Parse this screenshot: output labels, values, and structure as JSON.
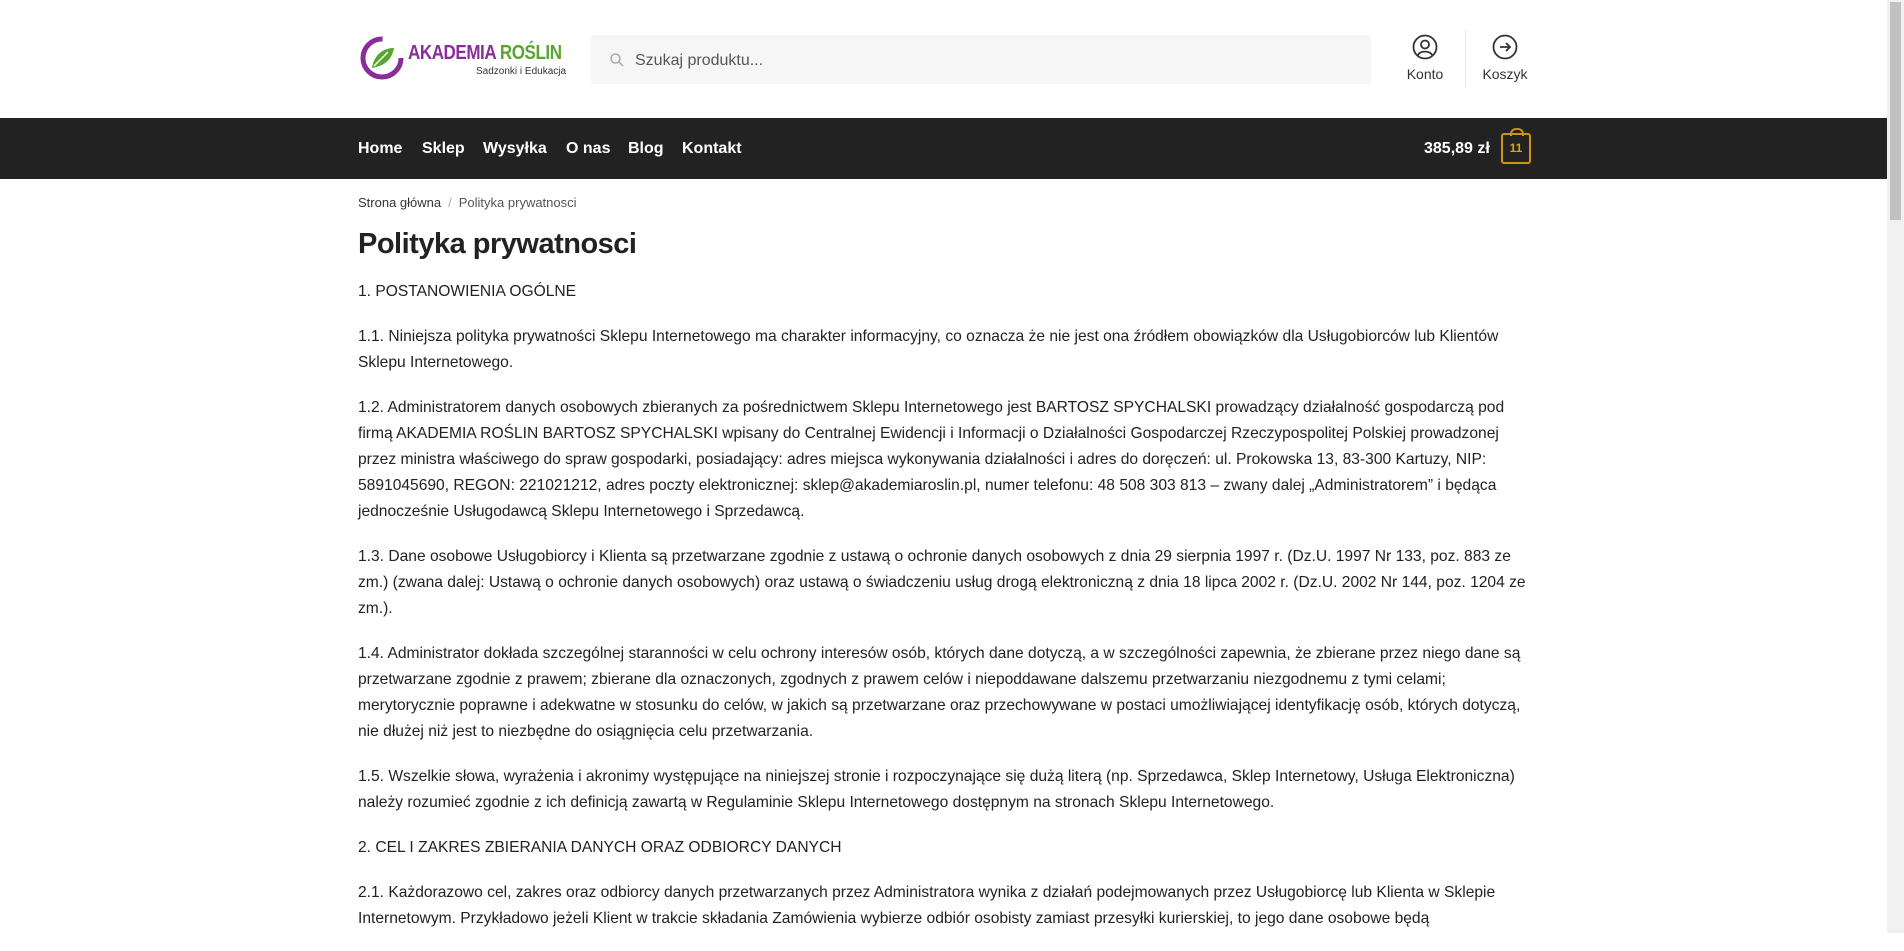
{
  "logo": {
    "title_main": "AKADEMIA ",
    "title_accent": "ROŚLIN",
    "subtitle": "Sadzonki i Edukacja"
  },
  "search": {
    "placeholder": "Szukaj produktu..."
  },
  "header_links": {
    "account_label": "Konto",
    "cart_label": "Koszyk"
  },
  "nav": {
    "items": [
      "Home",
      "Sklep",
      "Wysyłka",
      "O nas",
      "Blog",
      "Kontakt"
    ]
  },
  "cart": {
    "total": "385,89 zł",
    "count": "11"
  },
  "breadcrumb": {
    "home": "Strona główna",
    "current": "Polityka prywatnosci"
  },
  "page": {
    "title": "Polityka prywatnosci",
    "paragraphs": [
      "1. POSTANOWIENIA OGÓLNE",
      "1.1. Niniejsza polityka prywatności Sklepu Internetowego ma charakter informacyjny, co oznacza że nie jest ona źródłem obowiązków dla Usługobiorców lub Klientów Sklepu Internetowego.",
      "1.2. Administratorem danych osobowych zbieranych za pośrednictwem Sklepu Internetowego jest BARTOSZ SPYCHALSKI prowadzący działalność gospodarczą pod firmą AKADEMIA ROŚLIN BARTOSZ SPYCHALSKI wpisany do Centralnej Ewidencji i Informacji o Działalności Gospodarczej Rzeczypospolitej Polskiej prowadzonej przez ministra właściwego do spraw gospodarki, posiadający: adres miejsca wykonywania działalności i adres do doręczeń: ul. Prokowska 13, 83-300 Kartuzy, NIP: 5891045690, REGON: 221021212, adres poczty elektronicznej: sklep@akademiaroslin.pl, numer telefonu: 48 508 303 813 – zwany dalej „Administratorem” i będąca jednocześnie Usługodawcą Sklepu Internetowego i Sprzedawcą.",
      "1.3. Dane osobowe Usługobiorcy i Klienta są przetwarzane zgodnie z ustawą o ochronie danych osobowych z dnia 29 sierpnia 1997 r. (Dz.U. 1997 Nr 133, poz. 883 ze zm.) (zwana dalej: Ustawą o ochronie danych osobowych) oraz ustawą o świadczeniu usług drogą elektroniczną z dnia 18 lipca 2002 r. (Dz.U. 2002 Nr 144, poz. 1204 ze zm.).",
      "1.4. Administrator dokłada szczególnej staranności w celu ochrony interesów osób, których dane dotyczą, a w szczególności zapewnia, że zbierane przez niego dane są przetwarzane zgodnie z prawem; zbierane dla oznaczonych, zgodnych z prawem celów i niepoddawane dalszemu przetwarzaniu niezgodnemu z tymi celami; merytorycznie poprawne i adekwatne w stosunku do celów, w jakich są przetwarzane oraz przechowywane w postaci umożliwiającej identyfikację osób, których dotyczą, nie dłużej niż jest to niezbędne do osiągnięcia celu przetwarzania.",
      "1.5. Wszelkie słowa, wyrażenia i akronimy występujące na niniejszej stronie i rozpoczynające się dużą literą (np. Sprzedawca, Sklep Internetowy, Usługa Elektroniczna) należy rozumieć zgodnie z ich definicją zawartą w Regulaminie Sklepu Internetowego dostępnym na stronach Sklepu Internetowego.",
      "2. CEL I ZAKRES ZBIERANIA DANYCH ORAZ ODBIORCY DANYCH",
      "2.1. Każdorazowo cel, zakres oraz odbiorcy danych przetwarzanych przez Administratora wynika z działań podejmowanych przez Usługobiorcę lub Klienta w Sklepie Internetowym. Przykładowo jeżeli Klient w trakcie składania Zamówienia wybierze odbiór osobisty zamiast przesyłki kurierskiej, to jego dane osobowe będą"
    ]
  },
  "colors": {
    "nav_bg": "#222222",
    "cart_badge": "#c99514",
    "logo_purple": "#8a2d9a",
    "logo_green": "#5aa532"
  },
  "icons": {
    "search": "search-icon",
    "account": "user-circle-icon",
    "cart": "arrow-right-circle-icon",
    "logo": "leaf-logo-icon"
  }
}
